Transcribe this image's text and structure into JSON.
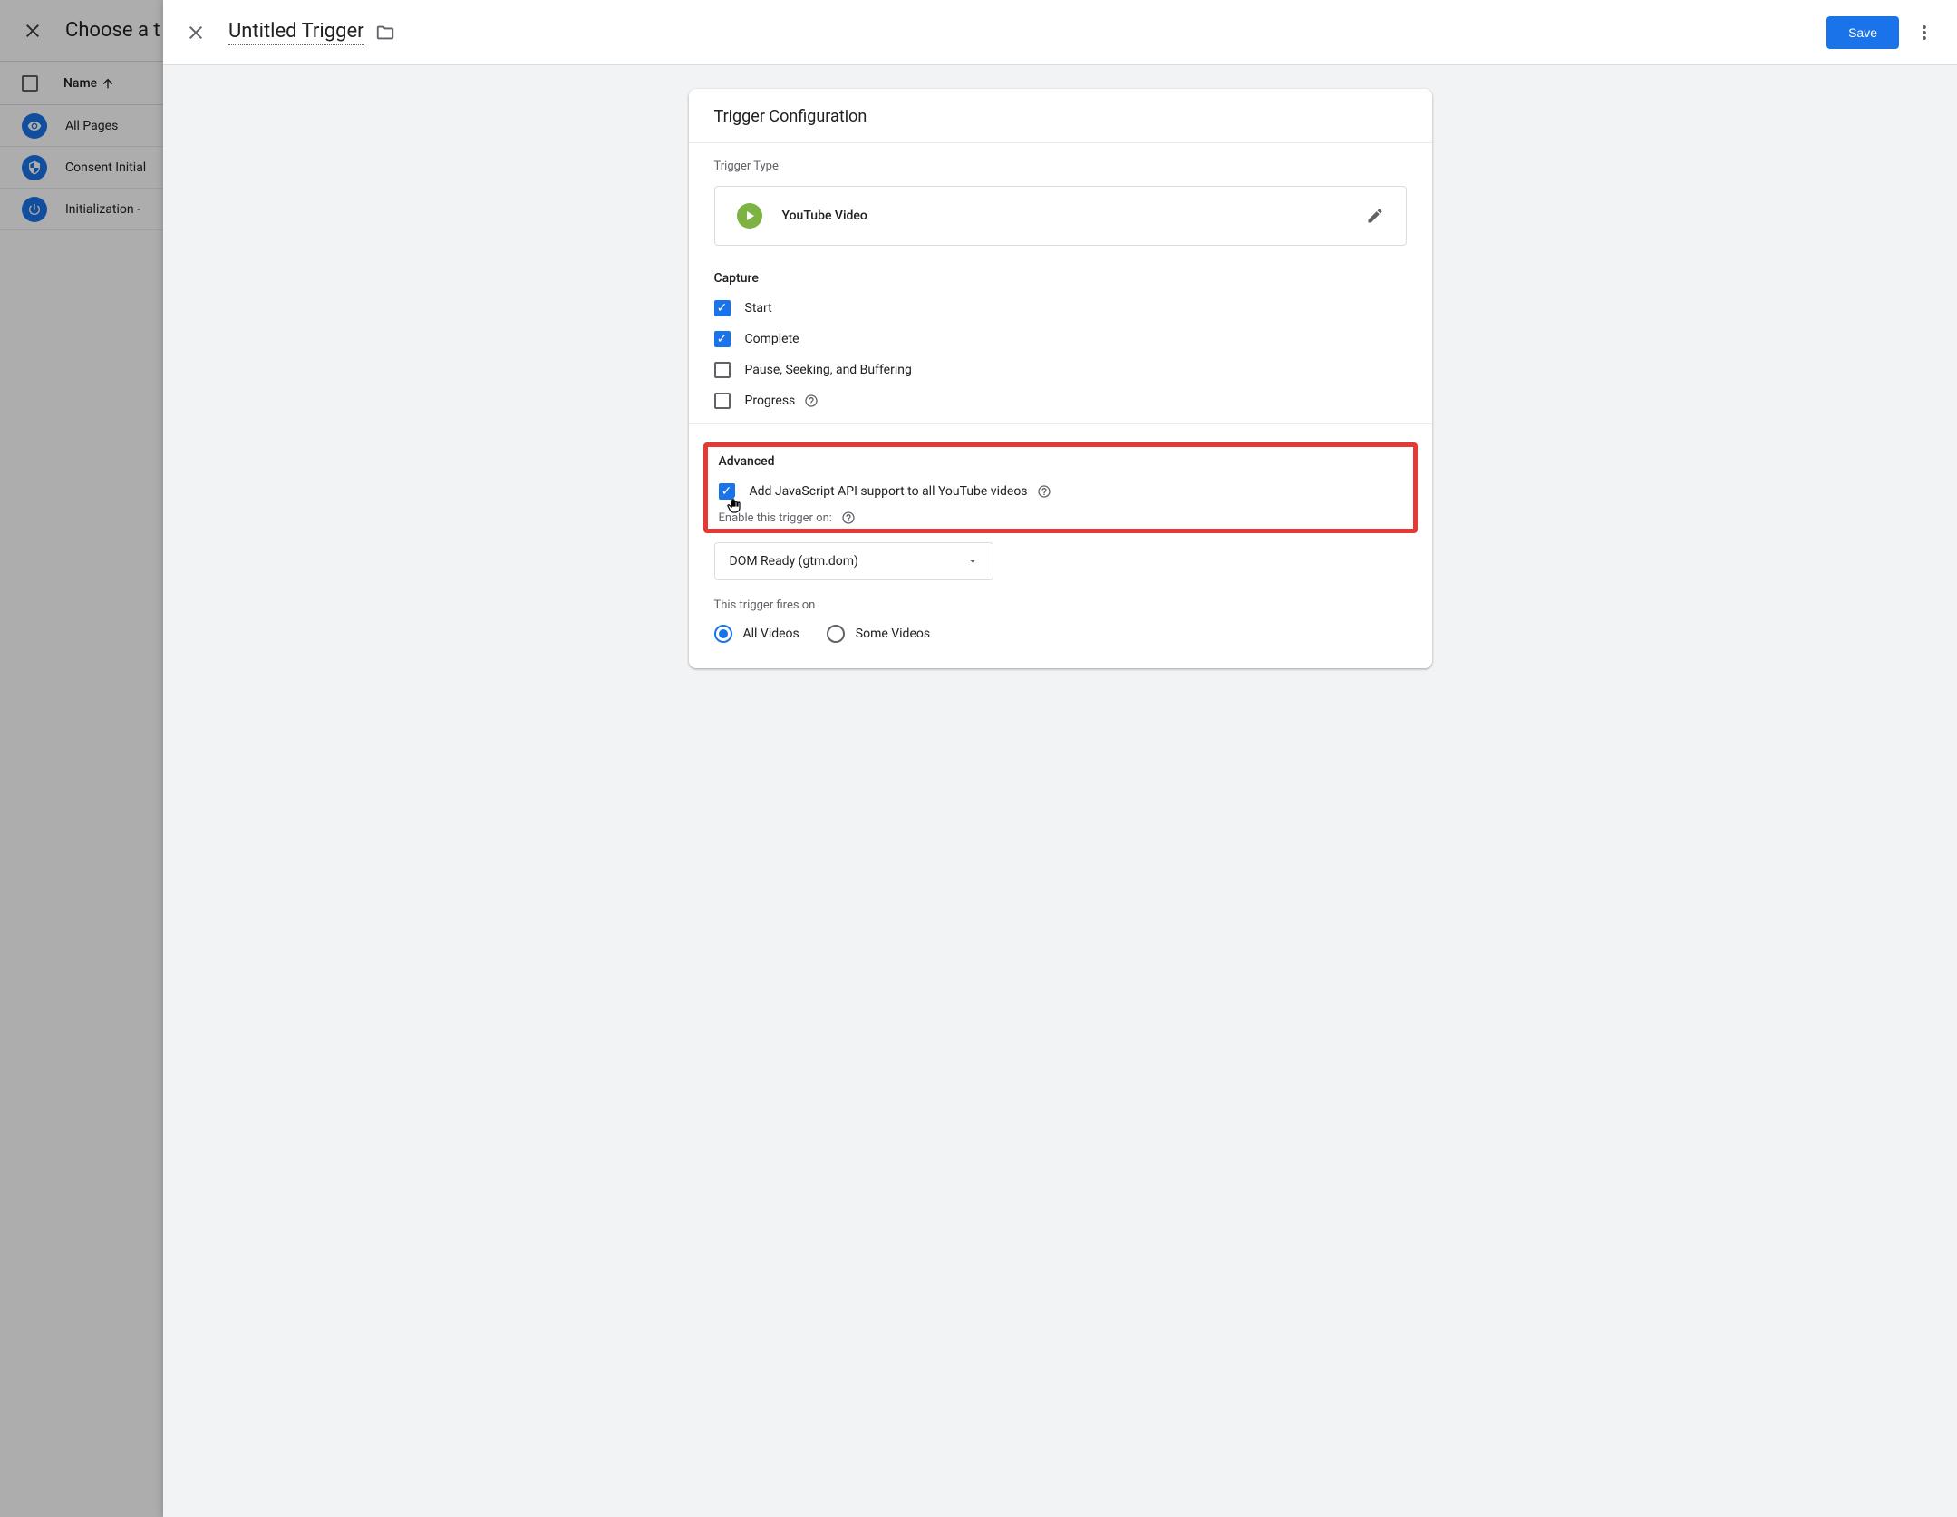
{
  "background": {
    "title": "Choose a t",
    "nameHeader": "Name",
    "rows": [
      {
        "label": "All Pages",
        "icon": "eye"
      },
      {
        "label": "Consent Initial",
        "icon": "shield"
      },
      {
        "label": "Initialization - ",
        "icon": "power"
      }
    ]
  },
  "panel": {
    "title": "Untitled Trigger",
    "saveLabel": "Save"
  },
  "card": {
    "title": "Trigger Configuration",
    "triggerTypeLabel": "Trigger Type",
    "triggerTypeName": "YouTube Video",
    "captureTitle": "Capture",
    "captureOptions": [
      {
        "label": "Start",
        "checked": true
      },
      {
        "label": "Complete",
        "checked": true
      },
      {
        "label": "Pause, Seeking, and Buffering",
        "checked": false
      },
      {
        "label": "Progress",
        "checked": false,
        "help": true
      }
    ],
    "advancedTitle": "Advanced",
    "jsApiLabel": "Add JavaScript API support to all YouTube videos",
    "jsApiChecked": true,
    "enableLabel": "Enable this trigger on:",
    "enableSelect": "DOM Ready (gtm.dom)",
    "firesLabel": "This trigger fires on",
    "radioOptions": [
      {
        "label": "All Videos",
        "selected": true
      },
      {
        "label": "Some Videos",
        "selected": false
      }
    ]
  }
}
